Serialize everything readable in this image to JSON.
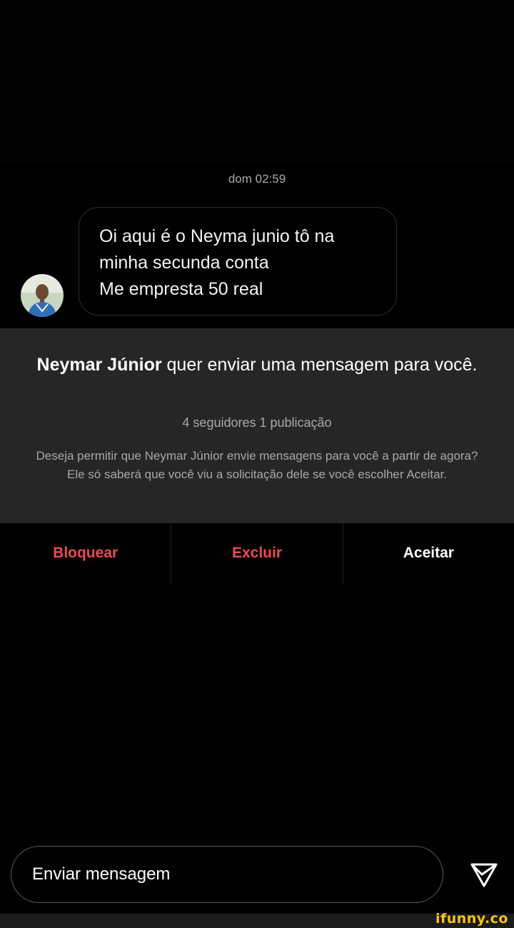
{
  "conversation": {
    "timestamp": "dom 02:59",
    "message_text": "Oi aqui é o Neyma junio tô na\nminha secunda conta\nMe empresta 50 real"
  },
  "request": {
    "sender_name": "Neymar Júnior",
    "title_rest": " quer enviar uma mensagem para você.",
    "stats": "4 seguidores 1 publicação",
    "description": "Deseja permitir que Neymar Júnior envie mensagens para você a partir de agora? Ele só saberá que você viu a solicitação dele se você escolher Aceitar."
  },
  "actions": {
    "block_label": "Bloquear",
    "delete_label": "Excluir",
    "accept_label": "Aceitar"
  },
  "composer": {
    "placeholder": "Enviar mensagem"
  },
  "icons": {
    "send": "send-paper-plane-icon",
    "avatar": "user-avatar"
  },
  "colors": {
    "danger": "#ed4956",
    "panel": "#262626",
    "watermark": "#f5c517"
  },
  "watermark": {
    "text": "ifunny.co"
  }
}
